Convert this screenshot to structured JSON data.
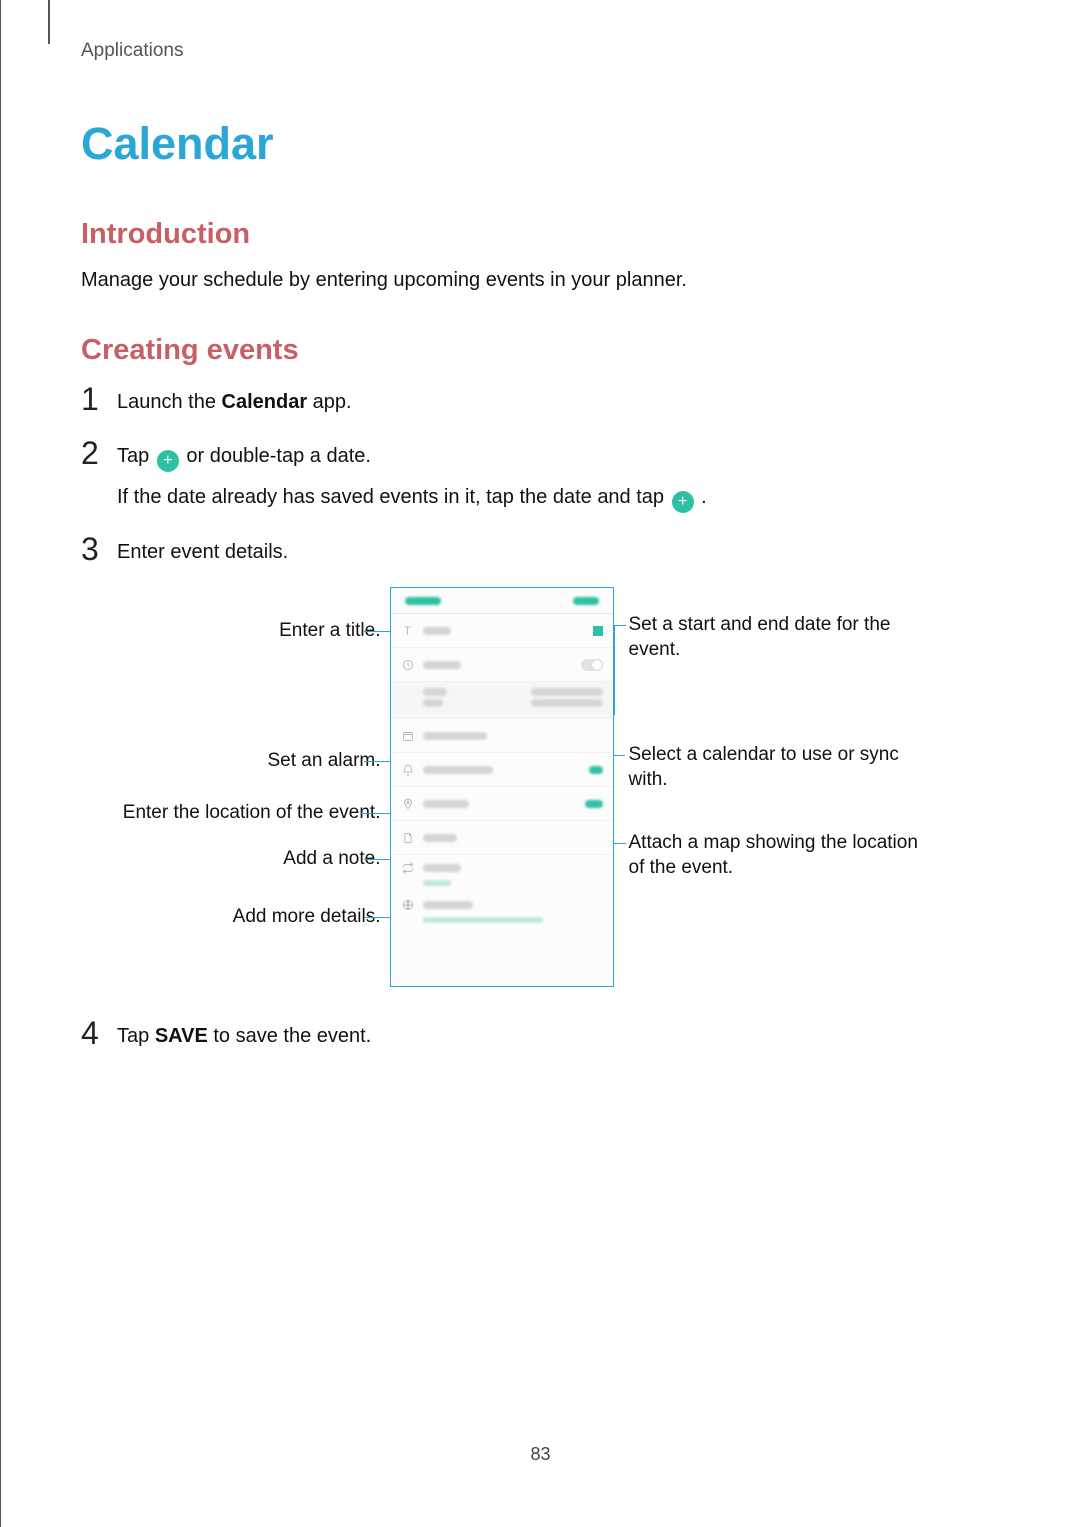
{
  "breadcrumb": "Applications",
  "title": "Calendar",
  "section_introduction": {
    "heading": "Introduction",
    "text": "Manage your schedule by entering upcoming events in your planner."
  },
  "section_creating": {
    "heading": "Creating events",
    "steps": {
      "s1_num": "1",
      "s1_prefix": "Launch the ",
      "s1_bold": "Calendar",
      "s1_suffix": " app.",
      "s2_num": "2",
      "s2_l1_prefix": "Tap ",
      "s2_l1_suffix": " or double-tap a date.",
      "s2_l2_prefix": "If the date already has saved events in it, tap the date and tap ",
      "s2_l2_suffix": ".",
      "s3_num": "3",
      "s3_text": "Enter event details.",
      "s4_num": "4",
      "s4_prefix": "Tap ",
      "s4_bold": "SAVE",
      "s4_suffix": " to save the event."
    }
  },
  "callouts": {
    "left1": "Enter a title.",
    "left2": "Set an alarm.",
    "left3": "Enter the location of the event.",
    "left4": "Add a note.",
    "left5": "Add more details.",
    "right1": "Set a start and end date for the event.",
    "right2": "Select a calendar to use or sync with.",
    "right3": "Attach a map showing the location of the event."
  },
  "icons": {
    "plus": "+"
  },
  "page_number": "83"
}
